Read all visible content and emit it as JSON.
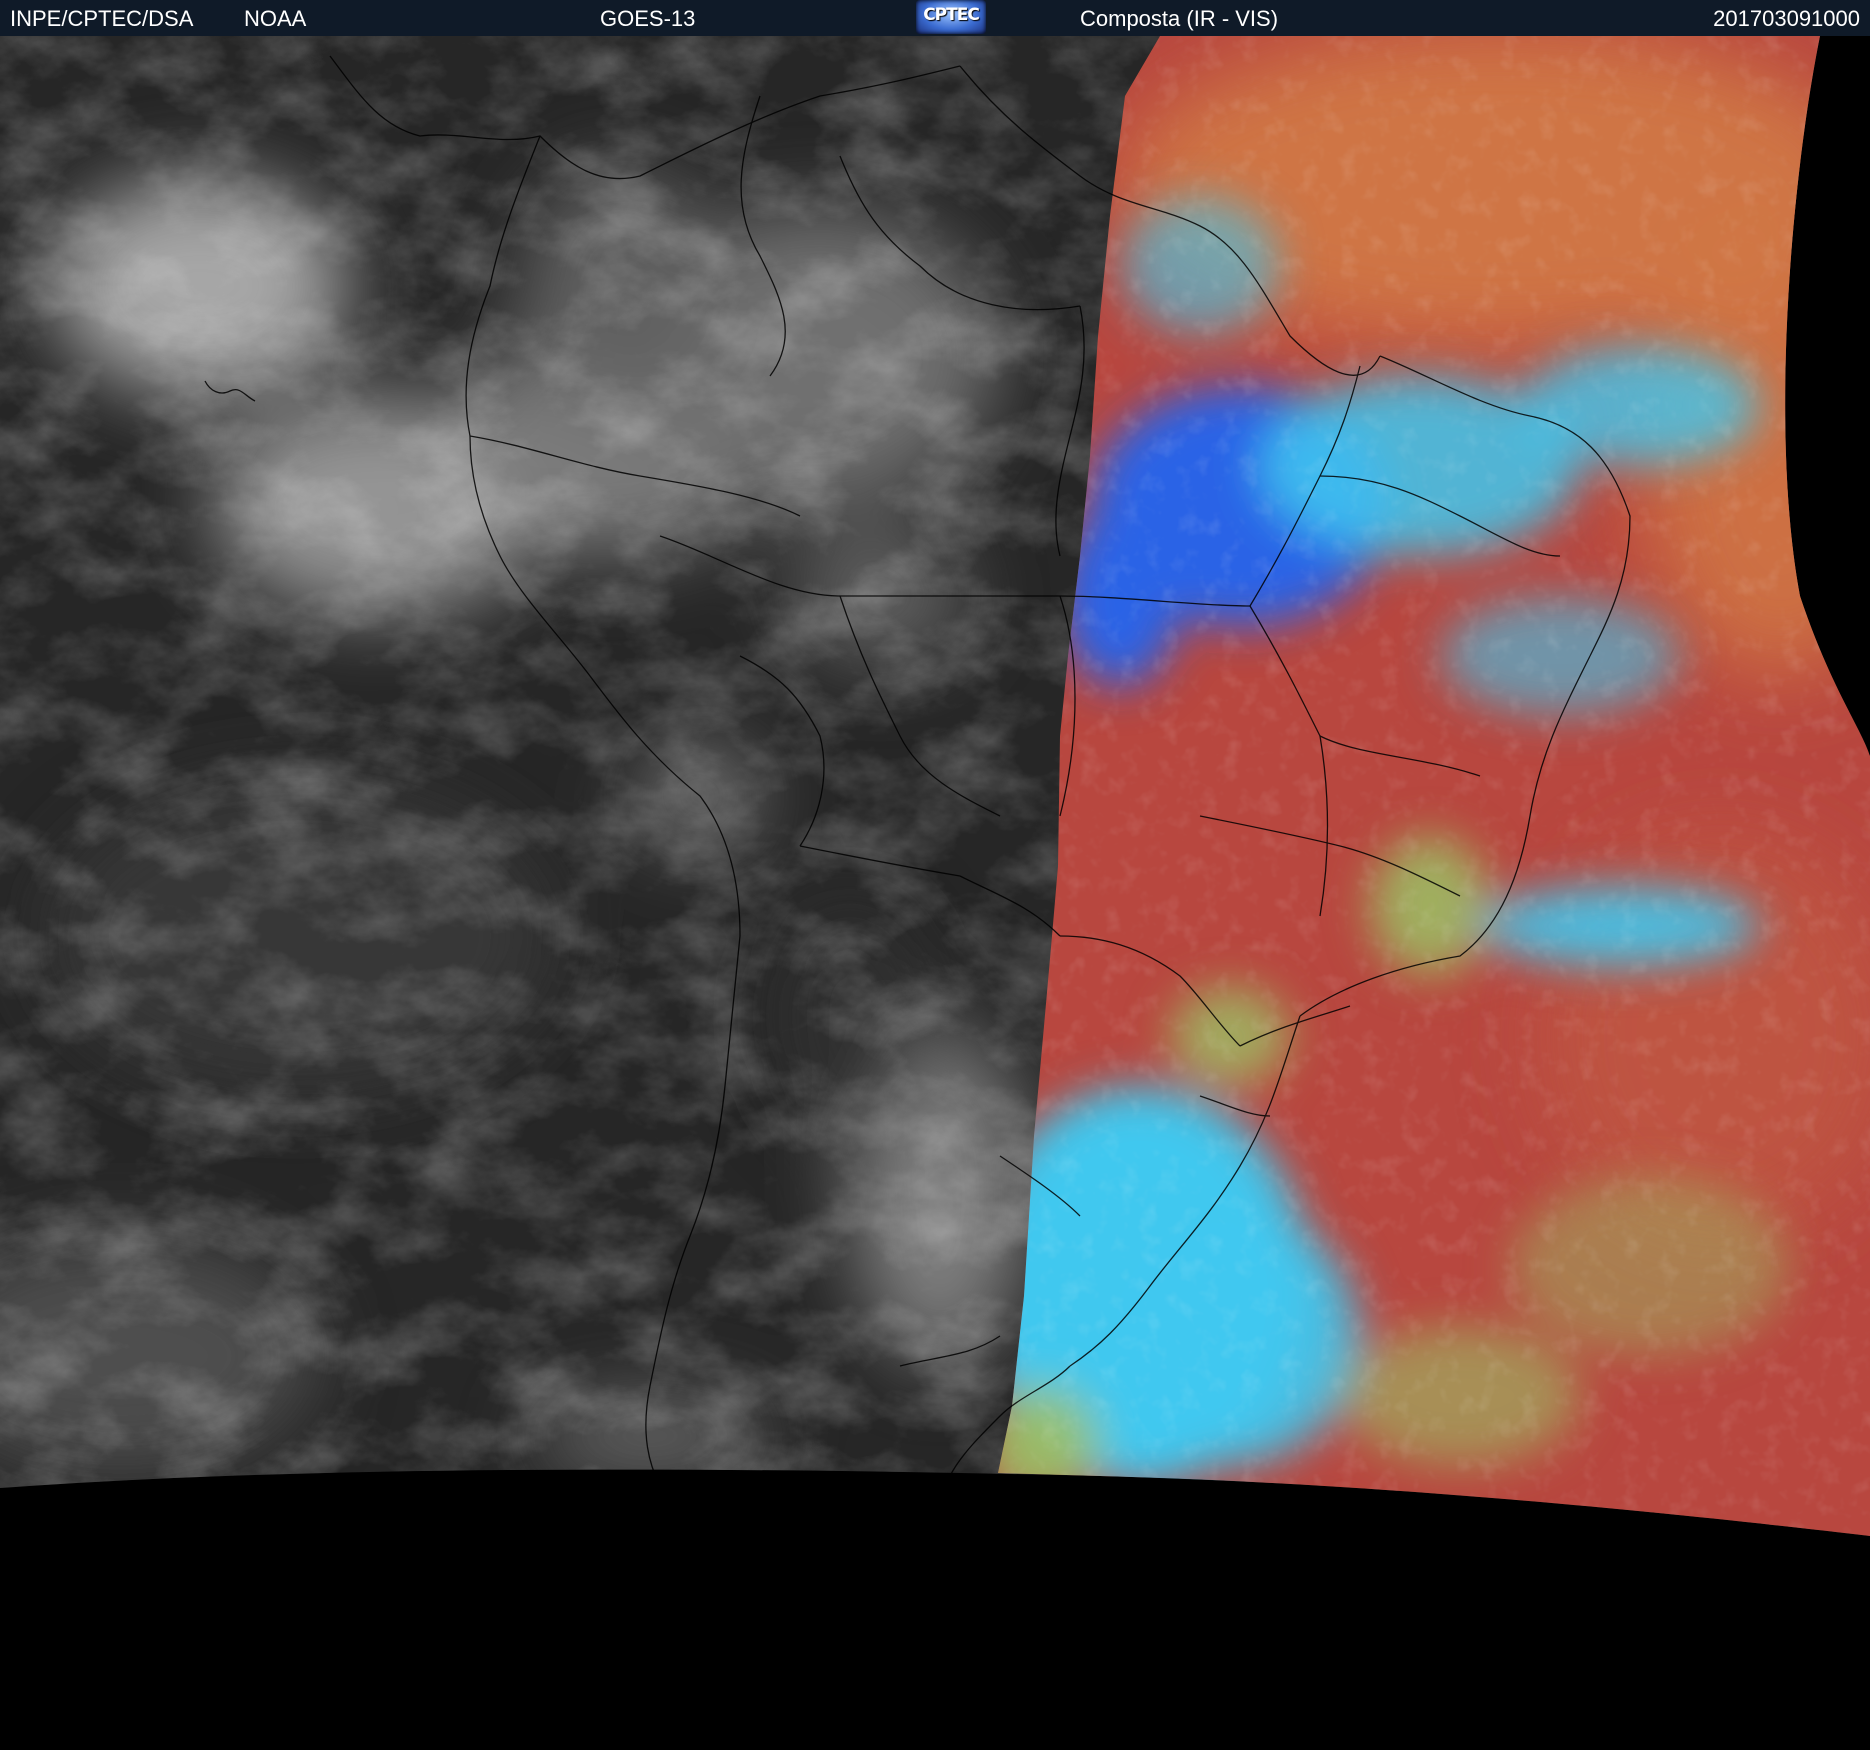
{
  "header": {
    "organization": "INPE/CPTEC/DSA",
    "agency": "NOAA",
    "satellite": "GOES-13",
    "logo_text": "CPTEC",
    "product": "Composta (IR - VIS)",
    "timestamp": "201703091000"
  },
  "colors": {
    "header_bg": "#0f1a28",
    "ir_gray_dark": "#262626",
    "ir_gray_light": "#9a9a9a",
    "vis_red": "#b8473f",
    "vis_orange": "#d27a45",
    "vis_cyan": "#41c8ef",
    "vis_blue": "#2a63e6",
    "vis_green": "#9cc065",
    "space": "#000000",
    "border_lines": "#000000"
  }
}
